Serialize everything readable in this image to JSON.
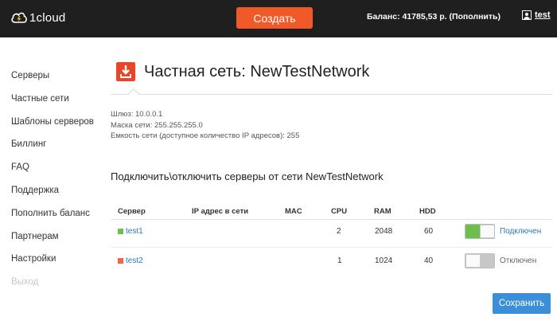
{
  "header": {
    "logo_text": "1cloud",
    "create_label": "Создать",
    "balance_text": "Баланс: 41785,53 р. (Пополнить)",
    "username": "test",
    "create_color": "#f05a28",
    "bar_color": "#1f1f1f"
  },
  "sidebar": {
    "items": [
      {
        "label": "Серверы"
      },
      {
        "label": "Частные сети"
      },
      {
        "label": "Шаблоны серверов"
      },
      {
        "label": "Биллинг"
      },
      {
        "label": "FAQ"
      },
      {
        "label": "Поддержка"
      },
      {
        "label": "Пополнить баланс"
      },
      {
        "label": "Партнерам"
      },
      {
        "label": "Настройки"
      },
      {
        "label": "Выход",
        "disabled": true
      }
    ]
  },
  "page": {
    "title": "Частная сеть: NewTestNetwork",
    "title_icon": "download-icon",
    "info": {
      "gateway": "Шлюз: 10.0.0.1",
      "mask": "Маска сети: 255.255.255.0",
      "capacity": "Емкость сети (доступное количество IP адресов): 255"
    },
    "subtitle": "Подключить\\отключить серверы от сети NewTestNetwork"
  },
  "table": {
    "headers": {
      "server": "Сервер",
      "ip": "IP адрес в сети",
      "mac": "MAC",
      "cpu": "CPU",
      "ram": "RAM",
      "hdd": "HDD"
    },
    "rows": [
      {
        "name": "test1",
        "ip": "",
        "mac": "",
        "cpu": "2",
        "ram": "2048",
        "hdd": "60",
        "status": "Подключен",
        "connected": true,
        "square_color": "#6cbf4c",
        "status_color": "#2a7ab8"
      },
      {
        "name": "test2",
        "ip": "",
        "mac": "",
        "cpu": "1",
        "ram": "1024",
        "hdd": "40",
        "status": "Отключен",
        "connected": false,
        "square_color": "#f0664a",
        "status_color": "#666666"
      }
    ]
  },
  "actions": {
    "save_label": "Сохранить",
    "save_color": "#3b8fd9"
  }
}
